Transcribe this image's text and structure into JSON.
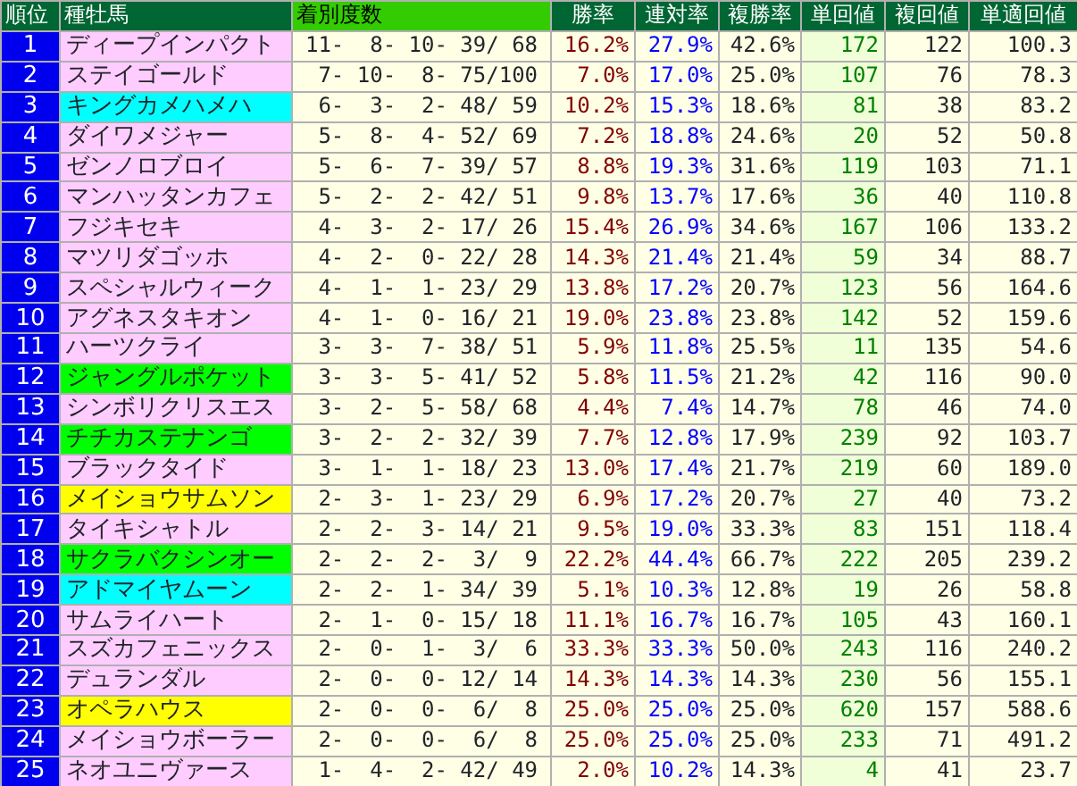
{
  "columns": [
    "順位",
    "種牡馬",
    "着別度数",
    "勝率",
    "連対率",
    "複勝率",
    "単回値",
    "複回値",
    "単適回値"
  ],
  "rows": [
    {
      "rank": "1",
      "sire": "ディープインパクト",
      "color": "#ffccff",
      "record": "11-  8- 10- 39/ 68",
      "win": "16.2%",
      "quinella": "27.9%",
      "show": "42.6%",
      "win_return": "172",
      "show_return": "122",
      "adjusted_return": "100.3"
    },
    {
      "rank": "2",
      "sire": "ステイゴールド",
      "color": "#ffccff",
      "record": " 7- 10-  8- 75/100",
      "win": "7.0%",
      "quinella": "17.0%",
      "show": "25.0%",
      "win_return": "107",
      "show_return": "76",
      "adjusted_return": "78.3"
    },
    {
      "rank": "3",
      "sire": "キングカメハメハ",
      "color": "#00ffff",
      "record": " 6-  3-  2- 48/ 59",
      "win": "10.2%",
      "quinella": "15.3%",
      "show": "18.6%",
      "win_return": "81",
      "show_return": "38",
      "adjusted_return": "83.2"
    },
    {
      "rank": "4",
      "sire": "ダイワメジャー",
      "color": "#ffccff",
      "record": " 5-  8-  4- 52/ 69",
      "win": "7.2%",
      "quinella": "18.8%",
      "show": "24.6%",
      "win_return": "20",
      "show_return": "52",
      "adjusted_return": "50.8"
    },
    {
      "rank": "5",
      "sire": "ゼンノロブロイ",
      "color": "#ffccff",
      "record": " 5-  6-  7- 39/ 57",
      "win": "8.8%",
      "quinella": "19.3%",
      "show": "31.6%",
      "win_return": "119",
      "show_return": "103",
      "adjusted_return": "71.1"
    },
    {
      "rank": "6",
      "sire": "マンハッタンカフェ",
      "color": "#ffccff",
      "record": " 5-  2-  2- 42/ 51",
      "win": "9.8%",
      "quinella": "13.7%",
      "show": "17.6%",
      "win_return": "36",
      "show_return": "40",
      "adjusted_return": "110.8"
    },
    {
      "rank": "7",
      "sire": "フジキセキ",
      "color": "#ffccff",
      "record": " 4-  3-  2- 17/ 26",
      "win": "15.4%",
      "quinella": "26.9%",
      "show": "34.6%",
      "win_return": "167",
      "show_return": "106",
      "adjusted_return": "133.2"
    },
    {
      "rank": "8",
      "sire": "マツリダゴッホ",
      "color": "#ffccff",
      "record": " 4-  2-  0- 22/ 28",
      "win": "14.3%",
      "quinella": "21.4%",
      "show": "21.4%",
      "win_return": "59",
      "show_return": "34",
      "adjusted_return": "88.7"
    },
    {
      "rank": "9",
      "sire": "スペシャルウィーク",
      "color": "#ffccff",
      "record": " 4-  1-  1- 23/ 29",
      "win": "13.8%",
      "quinella": "17.2%",
      "show": "20.7%",
      "win_return": "123",
      "show_return": "56",
      "adjusted_return": "164.6"
    },
    {
      "rank": "10",
      "sire": "アグネスタキオン",
      "color": "#ffccff",
      "record": " 4-  1-  0- 16/ 21",
      "win": "19.0%",
      "quinella": "23.8%",
      "show": "23.8%",
      "win_return": "142",
      "show_return": "52",
      "adjusted_return": "159.6"
    },
    {
      "rank": "11",
      "sire": "ハーツクライ",
      "color": "#ffccff",
      "record": " 3-  3-  7- 38/ 51",
      "win": "5.9%",
      "quinella": "11.8%",
      "show": "25.5%",
      "win_return": "11",
      "show_return": "135",
      "adjusted_return": "54.6"
    },
    {
      "rank": "12",
      "sire": "ジャングルポケット",
      "color": "#00ff00",
      "record": " 3-  3-  5- 41/ 52",
      "win": "5.8%",
      "quinella": "11.5%",
      "show": "21.2%",
      "win_return": "42",
      "show_return": "116",
      "adjusted_return": "90.0"
    },
    {
      "rank": "13",
      "sire": "シンボリクリスエス",
      "color": "#ffccff",
      "record": " 3-  2-  5- 58/ 68",
      "win": "4.4%",
      "quinella": "7.4%",
      "show": "14.7%",
      "win_return": "78",
      "show_return": "46",
      "adjusted_return": "74.0"
    },
    {
      "rank": "14",
      "sire": "チチカステナンゴ",
      "color": "#00ff00",
      "record": " 3-  2-  2- 32/ 39",
      "win": "7.7%",
      "quinella": "12.8%",
      "show": "17.9%",
      "win_return": "239",
      "show_return": "92",
      "adjusted_return": "103.7"
    },
    {
      "rank": "15",
      "sire": "ブラックタイド",
      "color": "#ffccff",
      "record": " 3-  1-  1- 18/ 23",
      "win": "13.0%",
      "quinella": "17.4%",
      "show": "21.7%",
      "win_return": "219",
      "show_return": "60",
      "adjusted_return": "189.0"
    },
    {
      "rank": "16",
      "sire": "メイショウサムソン",
      "color": "#ffff00",
      "record": " 2-  3-  1- 23/ 29",
      "win": "6.9%",
      "quinella": "17.2%",
      "show": "20.7%",
      "win_return": "27",
      "show_return": "40",
      "adjusted_return": "73.2"
    },
    {
      "rank": "17",
      "sire": "タイキシャトル",
      "color": "#ffccff",
      "record": " 2-  2-  3- 14/ 21",
      "win": "9.5%",
      "quinella": "19.0%",
      "show": "33.3%",
      "win_return": "83",
      "show_return": "151",
      "adjusted_return": "118.4"
    },
    {
      "rank": "18",
      "sire": "サクラバクシンオー",
      "color": "#00ff00",
      "record": " 2-  2-  2-  3/  9",
      "win": "22.2%",
      "quinella": "44.4%",
      "show": "66.7%",
      "win_return": "222",
      "show_return": "205",
      "adjusted_return": "239.2"
    },
    {
      "rank": "19",
      "sire": "アドマイヤムーン",
      "color": "#00ffff",
      "record": " 2-  2-  1- 34/ 39",
      "win": "5.1%",
      "quinella": "10.3%",
      "show": "12.8%",
      "win_return": "19",
      "show_return": "26",
      "adjusted_return": "58.8"
    },
    {
      "rank": "20",
      "sire": "サムライハート",
      "color": "#ffccff",
      "record": " 2-  1-  0- 15/ 18",
      "win": "11.1%",
      "quinella": "16.7%",
      "show": "16.7%",
      "win_return": "105",
      "show_return": "43",
      "adjusted_return": "160.1"
    },
    {
      "rank": "21",
      "sire": "スズカフェニックス",
      "color": "#ffccff",
      "record": " 2-  0-  1-  3/  6",
      "win": "33.3%",
      "quinella": "33.3%",
      "show": "50.0%",
      "win_return": "243",
      "show_return": "116",
      "adjusted_return": "240.2"
    },
    {
      "rank": "22",
      "sire": "デュランダル",
      "color": "#ffccff",
      "record": " 2-  0-  0- 12/ 14",
      "win": "14.3%",
      "quinella": "14.3%",
      "show": "14.3%",
      "win_return": "230",
      "show_return": "56",
      "adjusted_return": "155.1"
    },
    {
      "rank": "23",
      "sire": "オペラハウス",
      "color": "#ffff00",
      "record": " 2-  0-  0-  6/  8",
      "win": "25.0%",
      "quinella": "25.0%",
      "show": "25.0%",
      "win_return": "620",
      "show_return": "157",
      "adjusted_return": "588.6"
    },
    {
      "rank": "24",
      "sire": "メイショウボーラー",
      "color": "#ffccff",
      "record": " 2-  0-  0-  6/  8",
      "win": "25.0%",
      "quinella": "25.0%",
      "show": "25.0%",
      "win_return": "233",
      "show_return": "71",
      "adjusted_return": "491.2"
    },
    {
      "rank": "25",
      "sire": "ネオユニヴァース",
      "color": "#ffccff",
      "record": " 1-  4-  2- 42/ 49",
      "win": "2.0%",
      "quinella": "10.2%",
      "show": "14.3%",
      "win_return": "4",
      "show_return": "41",
      "adjusted_return": "23.7"
    }
  ]
}
